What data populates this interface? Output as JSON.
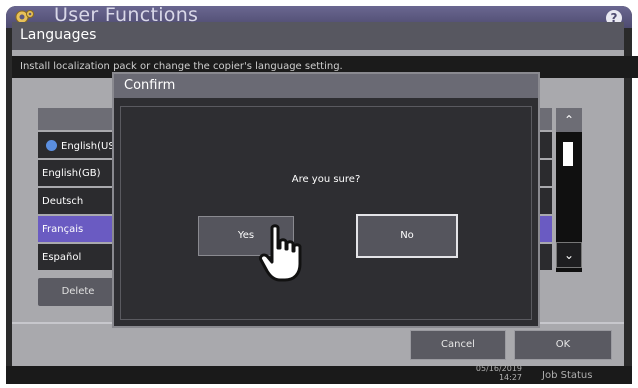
{
  "app": {
    "title": "User Functions",
    "help_label": "?"
  },
  "languages_panel": {
    "title": "Languages",
    "description": "Install localization pack or change the copier's language setting.",
    "list": [
      {
        "label": "English(US)",
        "installed": true
      },
      {
        "label": "English(GB)"
      },
      {
        "label": "Deutsch"
      },
      {
        "label": "Français",
        "selected": true
      },
      {
        "label": "Español"
      }
    ],
    "delete_label": "Delete",
    "cancel_label": "Cancel",
    "ok_label": "OK"
  },
  "confirm_dialog": {
    "title": "Confirm",
    "question": "Are you sure?",
    "yes_label": "Yes",
    "no_label": "No"
  },
  "status_bar": {
    "date": "05/16/2019",
    "time": "14:27",
    "job_status_label": "Job Status"
  },
  "colors": {
    "title_bar": "#5b5880",
    "selected_row": "#6a5bc2",
    "installed_check": "#5b8fe0"
  },
  "icons": {
    "app": "gear-icon",
    "help": "help-icon",
    "scroll_up": "chevron-up-icon",
    "scroll_down": "chevron-down-icon",
    "pointer": "hand-pointer-icon"
  }
}
